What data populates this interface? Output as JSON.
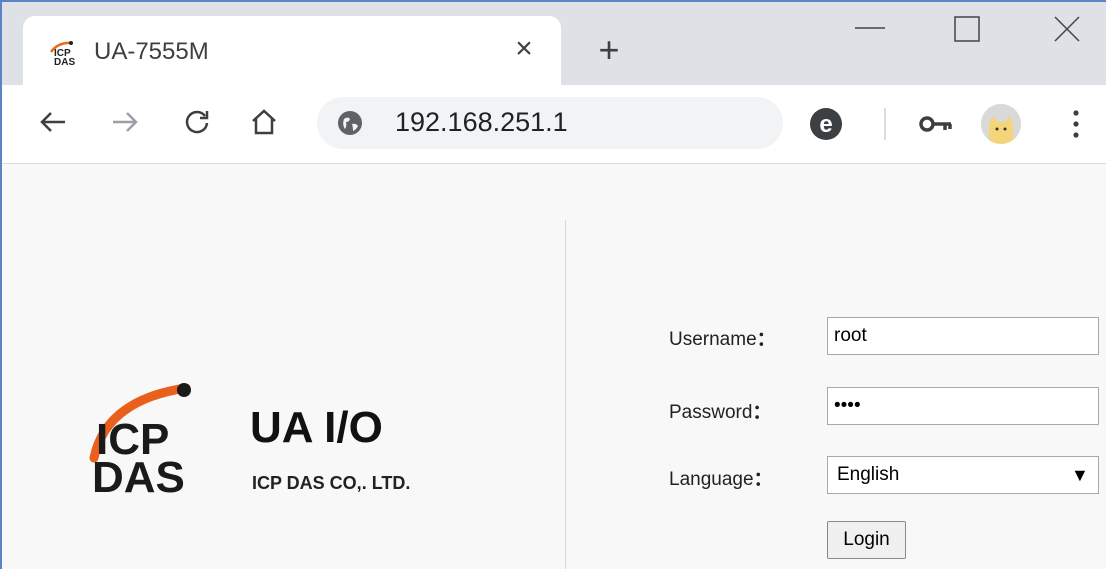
{
  "browser": {
    "tab": {
      "title": "UA-7555M",
      "favicon": "icp-das-favicon",
      "close_icon": "×"
    },
    "new_tab_icon": "+",
    "address": "192.168.251.1",
    "accent": "#5b84c4"
  },
  "page": {
    "brand": {
      "title": "UA I/O",
      "subtitle": "ICP DAS CO,. LTD.",
      "logo_text": "ICP DAS"
    },
    "form": {
      "username_label": "Username",
      "username_value": "root",
      "password_label": "Password",
      "password_value": "root",
      "language_label": "Language",
      "language_value": "English",
      "colon": "：",
      "login_label": "Login"
    }
  }
}
